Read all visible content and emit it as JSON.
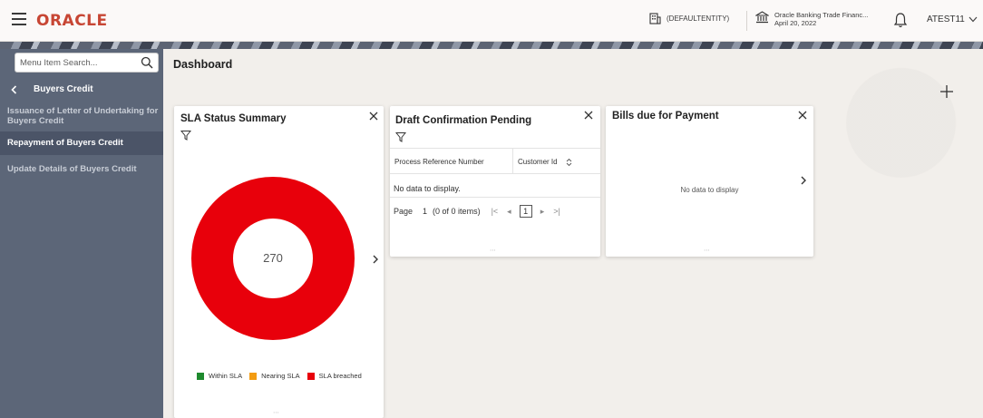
{
  "header": {
    "logo": "ORACLE",
    "entity": "(DEFAULTENTITY)",
    "branch_name": "Oracle Banking Trade Financ...",
    "branch_date": "April 20, 2022",
    "user": "ATEST11"
  },
  "sidebar": {
    "search_placeholder": "Menu Item Search...",
    "back_label": "Buyers Credit",
    "items": [
      {
        "label": "Issuance of Letter of Undertaking for Buyers Credit",
        "active": false
      },
      {
        "label": "Repayment of Buyers Credit",
        "active": true
      },
      {
        "label": "Update Details of Buyers Credit",
        "active": false
      }
    ]
  },
  "main": {
    "title": "Dashboard",
    "sla_card": {
      "title": "SLA Status Summary",
      "center_value": "270",
      "legend": [
        {
          "label": "Within SLA",
          "color": "#1e8a2e"
        },
        {
          "label": "Nearing SLA",
          "color": "#f39c12"
        },
        {
          "label": "SLA breached",
          "color": "#e8000b"
        }
      ],
      "slices": [
        {
          "label": "Within SLA",
          "value": 0
        },
        {
          "label": "Nearing SLA",
          "value": 0
        },
        {
          "label": "SLA breached",
          "value": 270
        }
      ]
    },
    "draft_card": {
      "title": "Draft Confirmation Pending",
      "columns": [
        "Process Reference Number",
        "Customer Id"
      ],
      "no_data": "No data to display.",
      "pager_label": "Page",
      "page_number": "1",
      "items_text": "(0 of 0 items)",
      "current_page": "1"
    },
    "bills_card": {
      "title": "Bills due for Payment",
      "no_data": "No data to display"
    }
  },
  "colors": {
    "accent": "#c74634",
    "sidebar_bg": "#5c6678",
    "sla_breached": "#e8000b"
  }
}
